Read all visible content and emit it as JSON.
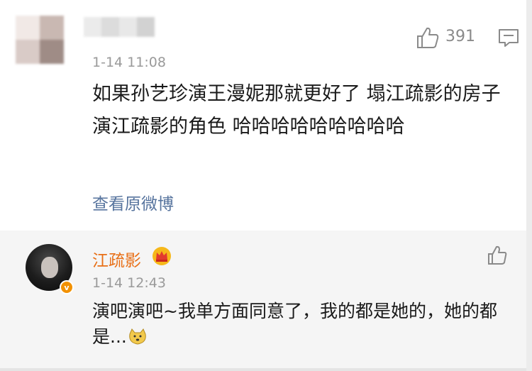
{
  "top_comment": {
    "like_count": "391",
    "timestamp": "1-14 11:08",
    "text": "如果孙艺珍演王漫妮那就更好了 塌江疏影的房子 演江疏影的角色 哈哈哈哈哈哈哈哈哈",
    "view_original_label": "查看原微博"
  },
  "reply": {
    "username": "江疏影",
    "timestamp": "1-14 12:43",
    "text": "演吧演吧~我单方面同意了，我的都是她的，她的都是...",
    "username_color": "#e86f16"
  },
  "icons": {
    "like": "thumbs-up-icon",
    "reply": "comment-icon",
    "crown": "crown-icon",
    "verified": "verified-badge-icon",
    "emoji": "doge-emoji-icon"
  }
}
